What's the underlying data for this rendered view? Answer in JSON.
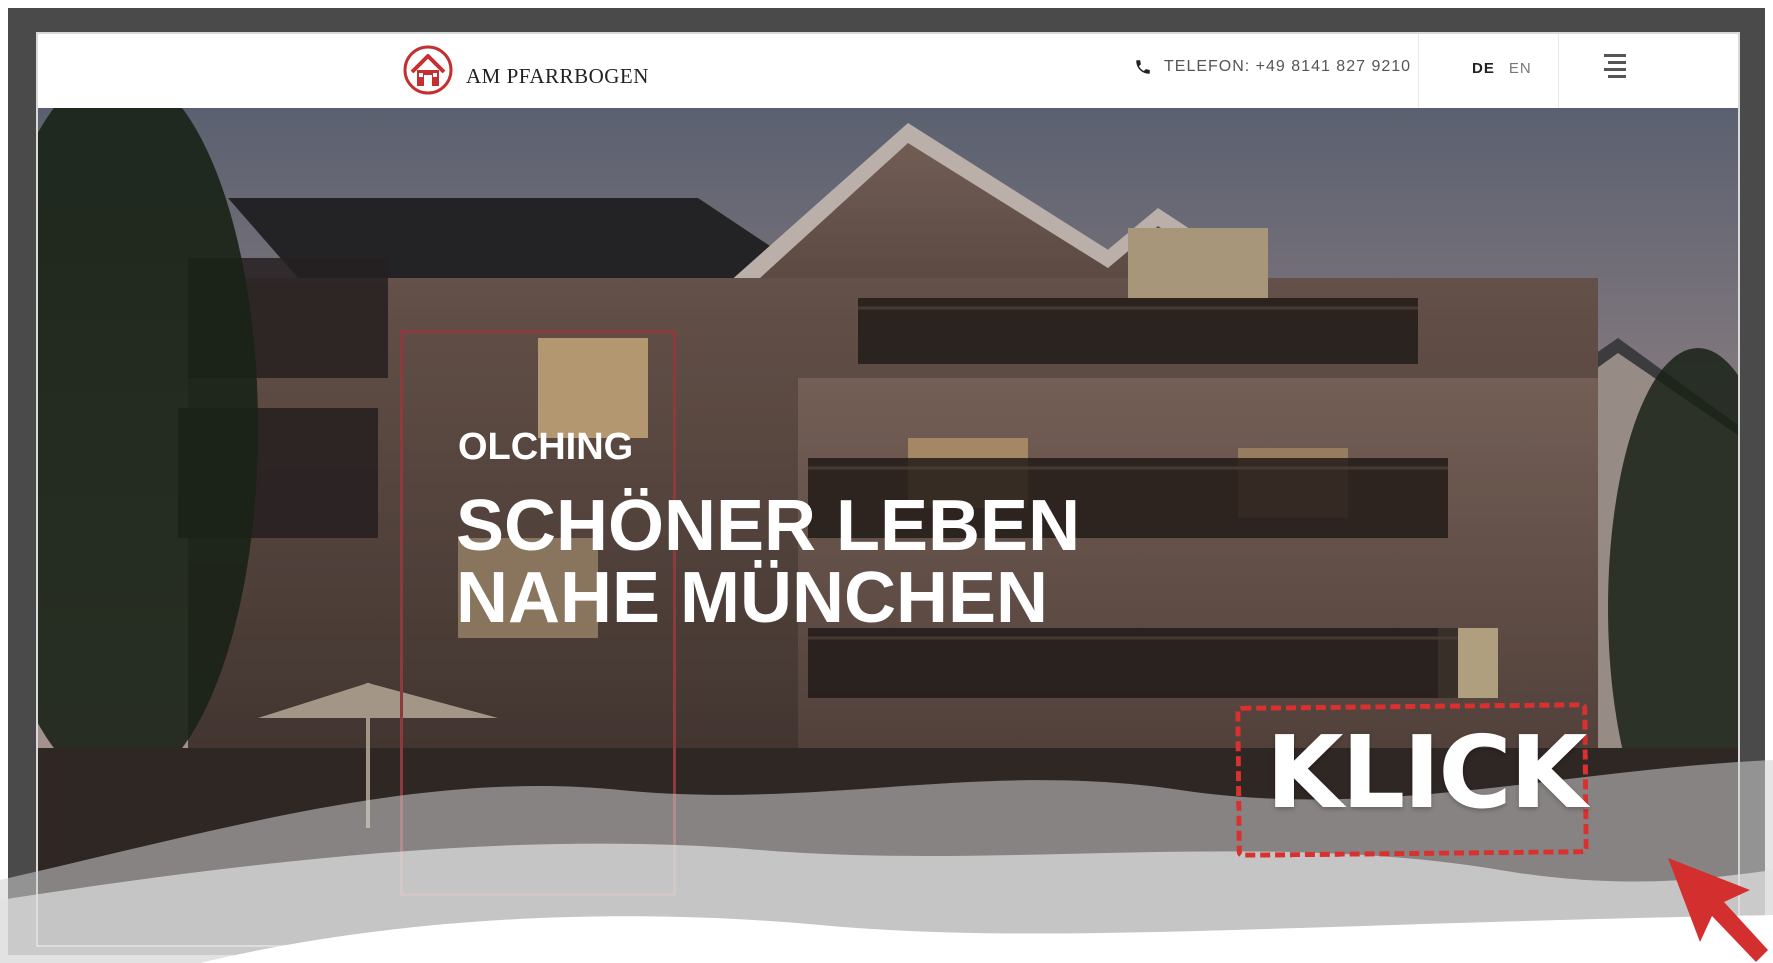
{
  "header": {
    "logo_text": "AM PFARRBOGEN",
    "logo_icon": "house-icon",
    "phone_label": "TELEFON: +49 8141 827 9210",
    "phone_icon": "phone-icon",
    "languages": [
      {
        "code": "DE",
        "active": true
      },
      {
        "code": "EN",
        "active": false
      }
    ],
    "menu_icon": "hamburger-menu-icon"
  },
  "hero": {
    "kicker": "OLCHING",
    "title_line1": "SCHÖNER LEBEN",
    "title_line2": "NAHE MÜNCHEN"
  },
  "callout": {
    "text": "KLICK",
    "pointer_icon": "arrow-cursor-icon"
  },
  "colors": {
    "brand_red": "#c62f32",
    "frame_red": "#8c3a3c",
    "callout_red": "#d93030",
    "header_bg": "#ffffff"
  }
}
